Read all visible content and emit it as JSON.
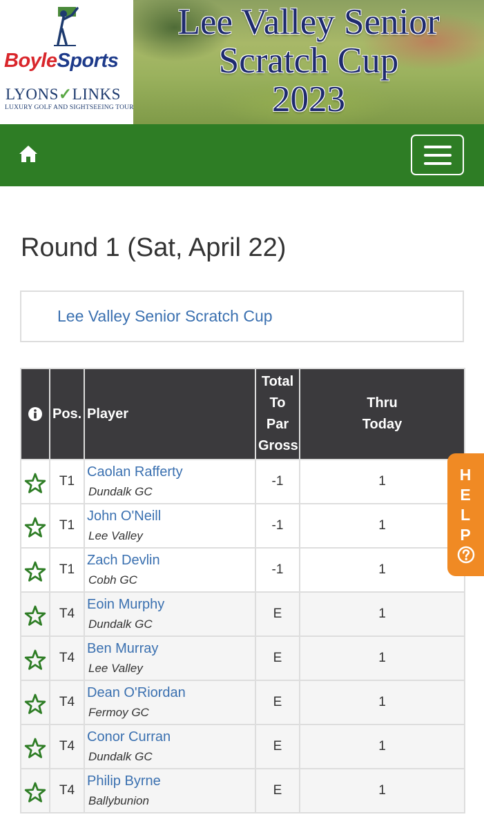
{
  "banner": {
    "sponsor1": {
      "part1": "Boyle",
      "part2": "Sports"
    },
    "sponsor2": {
      "part1": "LYONS",
      "part2": "LINKS",
      "tagline": "LUXURY GOLF AND SIGHTSEEING TOURS"
    },
    "title_line1": "Lee Valley Senior",
    "title_line2": "Scratch Cup",
    "title_line3": "2023"
  },
  "nav": {
    "home_icon": "home-icon",
    "menu_icon": "hamburger-menu-icon"
  },
  "page": {
    "title": "Round 1 (Sat, April 22)",
    "event_link": "Lee Valley Senior Scratch Cup"
  },
  "table": {
    "headers": {
      "info_icon": "info-icon",
      "pos": "Pos.",
      "player": "Player",
      "total_line1": "Total",
      "total_line2": "To",
      "total_line3": "Par",
      "total_line4": "Gross",
      "thru_line1": "Thru",
      "thru_line2": "Today"
    },
    "rows": [
      {
        "pos": "T1",
        "name": "Caolan Rafferty",
        "club": "Dundalk GC",
        "to_par": "-1",
        "thru": "1"
      },
      {
        "pos": "T1",
        "name": "John O'Neill",
        "club": "Lee Valley",
        "to_par": "-1",
        "thru": "1"
      },
      {
        "pos": "T1",
        "name": "Zach Devlin",
        "club": "Cobh GC",
        "to_par": "-1",
        "thru": "1"
      },
      {
        "pos": "T4",
        "name": "Eoin Murphy",
        "club": "Dundalk GC",
        "to_par": "E",
        "thru": "1"
      },
      {
        "pos": "T4",
        "name": "Ben Murray",
        "club": "Lee Valley",
        "to_par": "E",
        "thru": "1"
      },
      {
        "pos": "T4",
        "name": "Dean O'Riordan",
        "club": "Fermoy GC",
        "to_par": "E",
        "thru": "1"
      },
      {
        "pos": "T4",
        "name": "Conor Curran",
        "club": "Dundalk GC",
        "to_par": "E",
        "thru": "1"
      },
      {
        "pos": "T4",
        "name": "Philip Byrne",
        "club": "Ballybunion",
        "to_par": "E",
        "thru": "1"
      }
    ]
  },
  "help": {
    "l1": "H",
    "l2": "E",
    "l3": "L",
    "l4": "P"
  },
  "colors": {
    "nav_green": "#2e7d25",
    "header_dark": "#3b3a3d",
    "link_blue": "#3a70b0",
    "help_orange": "#f08a24",
    "star_green": "#2e7d25"
  }
}
